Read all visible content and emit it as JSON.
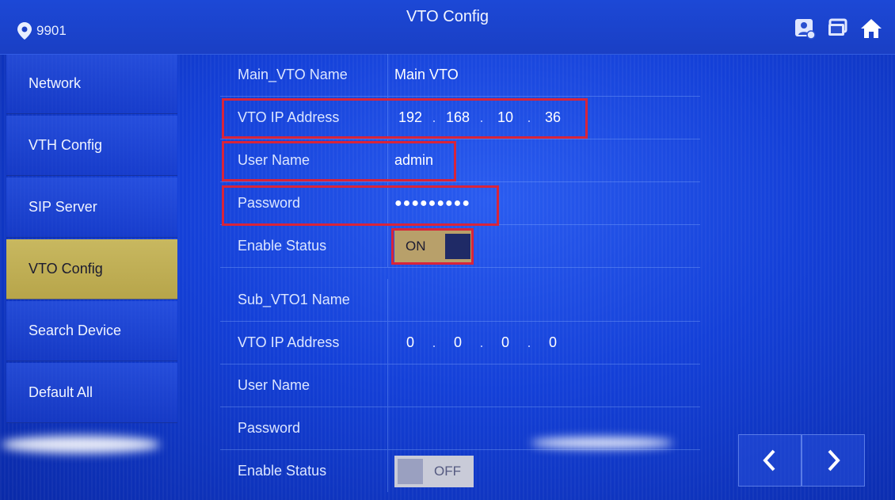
{
  "header": {
    "location": "9901",
    "title": "VTO Config",
    "icons": [
      "contact-card-icon",
      "monitor-icon",
      "home-icon"
    ]
  },
  "sidebar": {
    "items": [
      {
        "label": "Network",
        "active": false
      },
      {
        "label": "VTH Config",
        "active": false
      },
      {
        "label": "SIP Server",
        "active": false
      },
      {
        "label": "VTO Config",
        "active": true
      },
      {
        "label": "Search Device",
        "active": false
      },
      {
        "label": "Default All",
        "active": false
      }
    ]
  },
  "form": {
    "main_name_label": "Main_VTO Name",
    "main_name_value": "Main VTO",
    "main_ip_label": "VTO IP Address",
    "main_ip": [
      "192",
      "168",
      "10",
      "36"
    ],
    "main_user_label": "User Name",
    "main_user_value": "admin",
    "main_password_label": "Password",
    "main_password_value": "●●●●●●●●●",
    "main_enable_label": "Enable Status",
    "main_enable_value": "ON",
    "sub_name_label": "Sub_VTO1 Name",
    "sub_name_value": "",
    "sub_ip_label": "VTO IP Address",
    "sub_ip": [
      "0",
      "0",
      "0",
      "0"
    ],
    "sub_user_label": "User Name",
    "sub_user_value": "",
    "sub_password_label": "Password",
    "sub_password_value": "",
    "sub_enable_label": "Enable Status",
    "sub_enable_value": "OFF"
  },
  "nav": {
    "prev": "previous-page-icon",
    "next": "next-page-icon"
  },
  "colors": {
    "highlight": "#d8243a",
    "active_tab": "#c8b860",
    "background": "#1440d8"
  }
}
